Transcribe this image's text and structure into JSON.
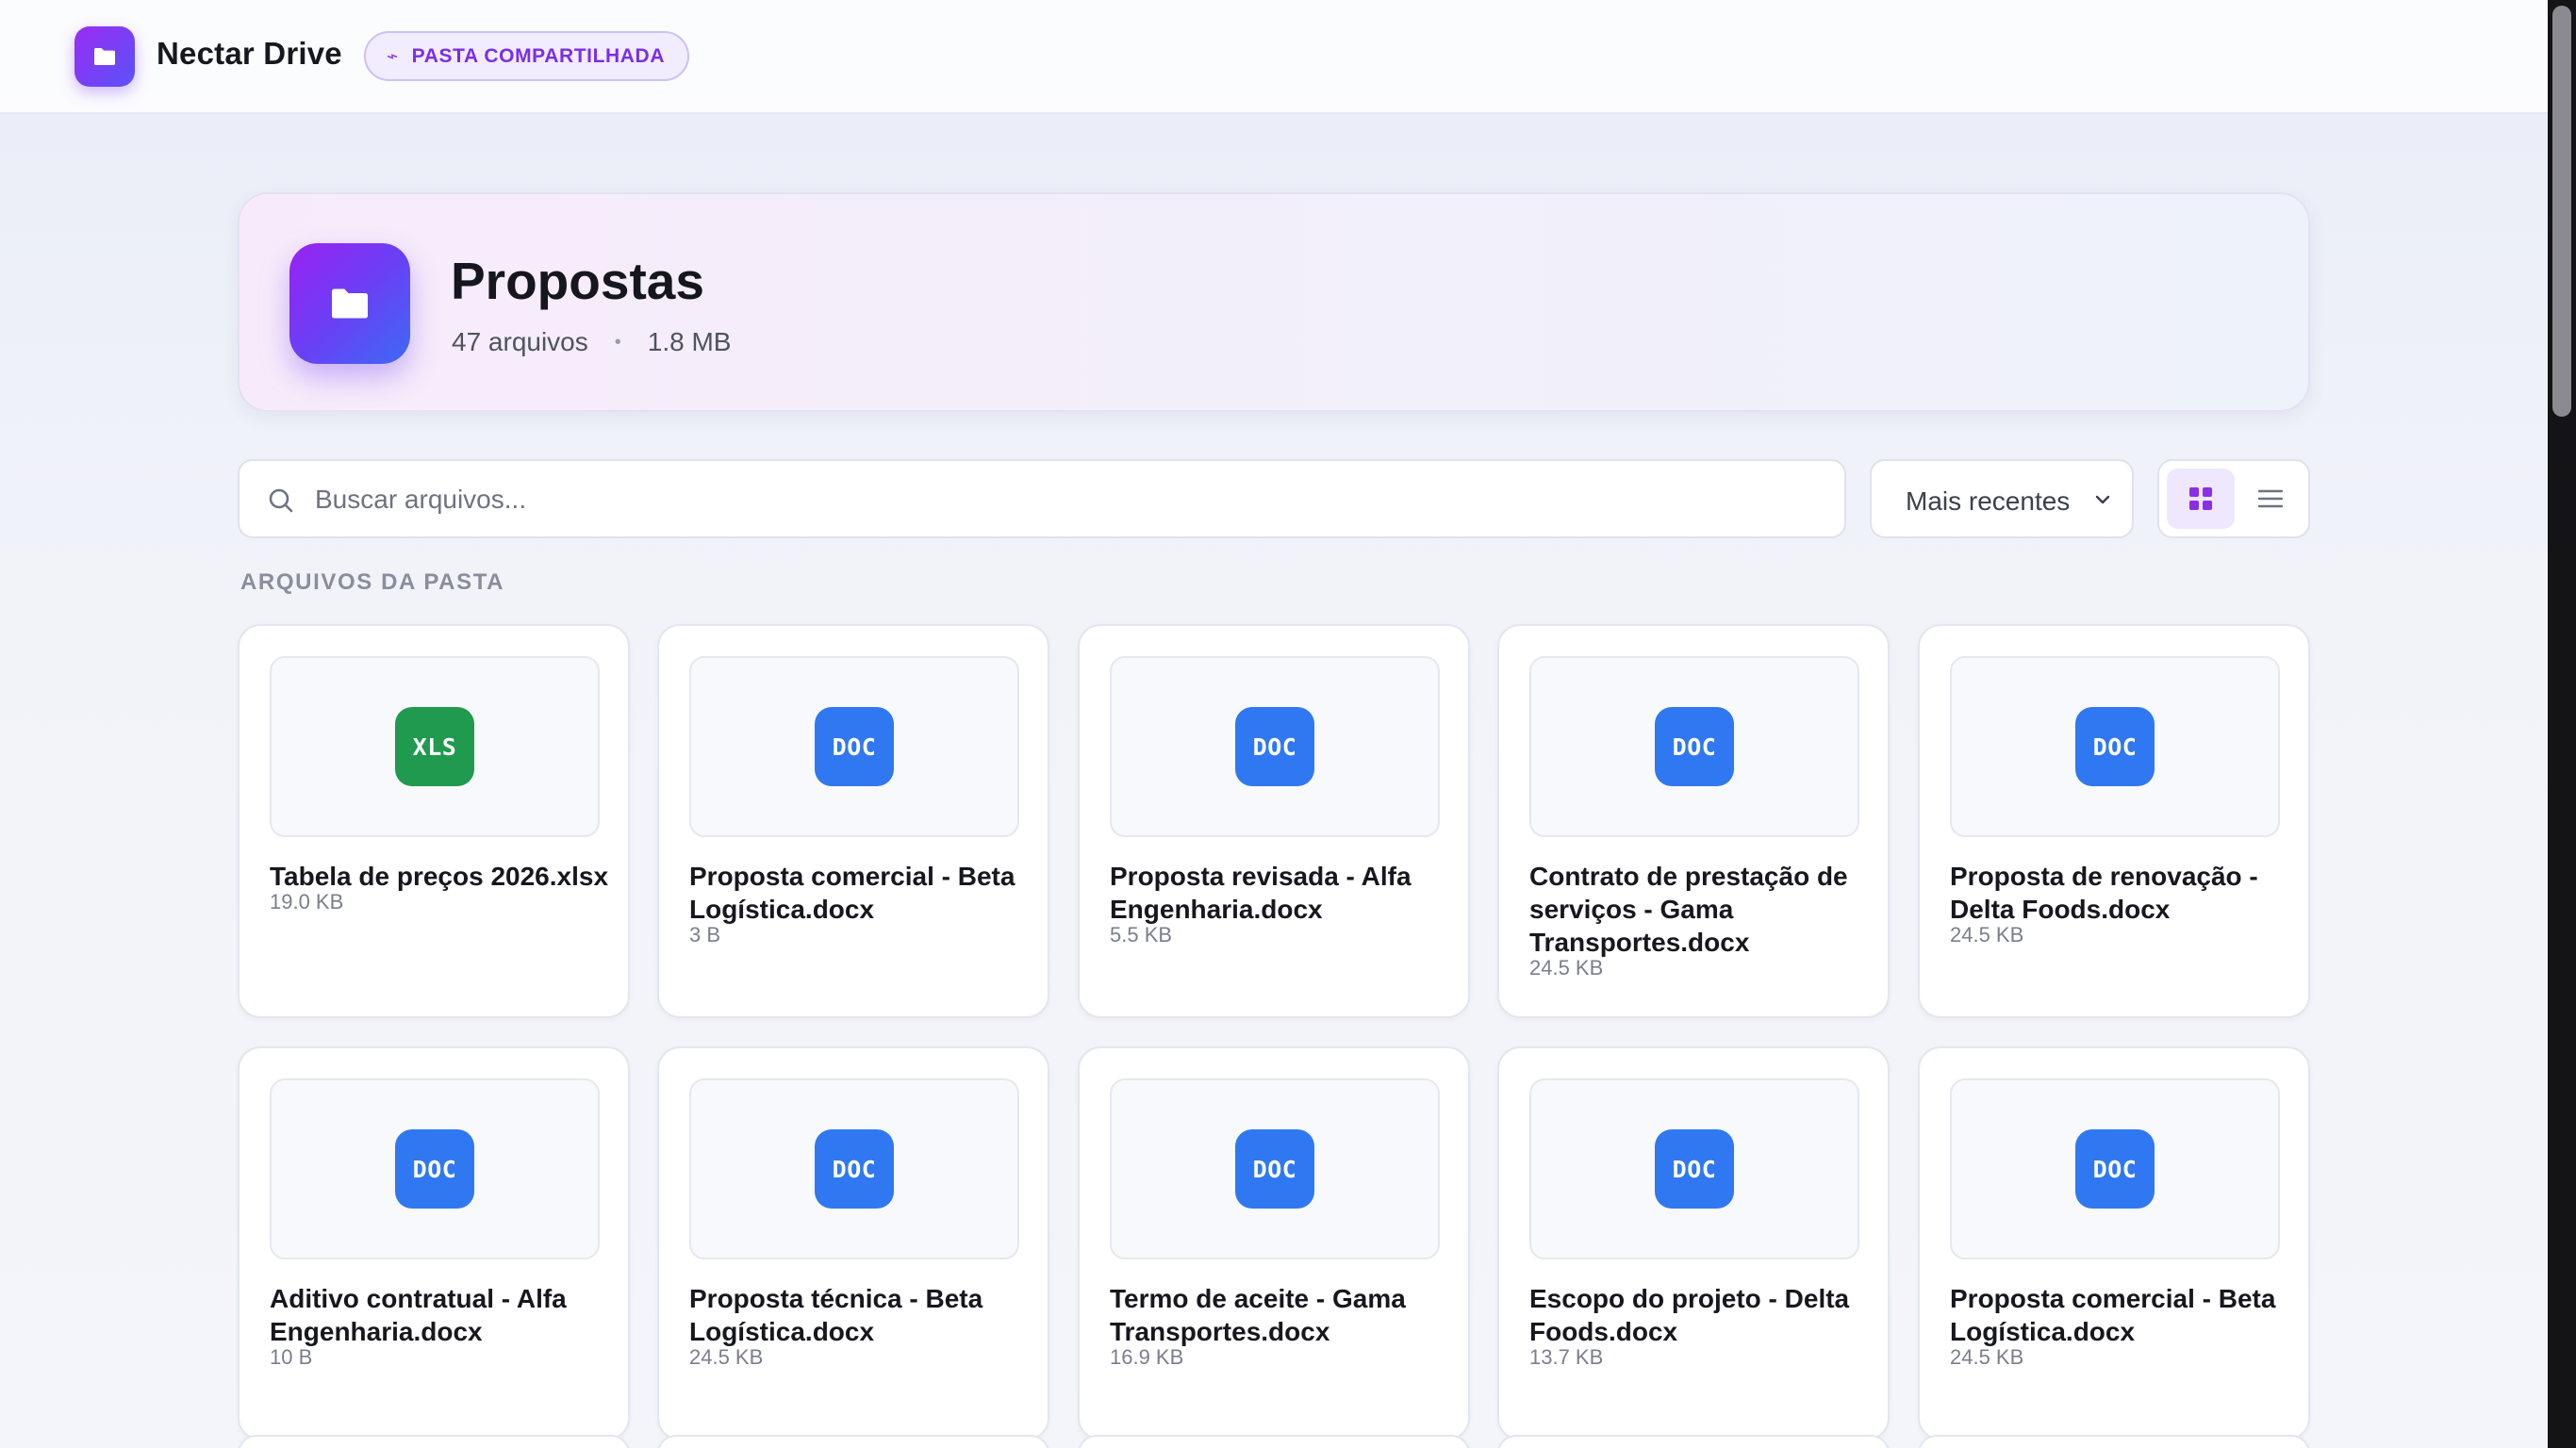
{
  "header": {
    "brand": "Nectar Drive",
    "badge_label": "PASTA COMPARTILHADA",
    "badge_icon": "link-icon",
    "logo_icon": "folder-icon"
  },
  "folder": {
    "name": "Propostas",
    "file_count": "47 arquivos",
    "separator": "•",
    "total_size": "1.8 MB",
    "icon": "folder-icon"
  },
  "search": {
    "placeholder": "Buscar arquivos...",
    "value": ""
  },
  "sort": {
    "selected": "Mais recentes"
  },
  "view_toggle": {
    "active": "grid"
  },
  "section_label": "ARQUIVOS DA PASTA",
  "colors": {
    "accent": "#7c3aed",
    "doc": "#2f78f1",
    "xls": "#1f9a4e"
  },
  "files": [
    {
      "type": "XLS",
      "name": "Tabela de preços 2026.xlsx",
      "size": "19.0 KB"
    },
    {
      "type": "DOC",
      "name": "Proposta comercial - Beta Logística.docx",
      "size": "3 B"
    },
    {
      "type": "DOC",
      "name": "Proposta revisada - Alfa Engenharia.docx",
      "size": "5.5 KB"
    },
    {
      "type": "DOC",
      "name": "Contrato de prestação de serviços - Gama Transportes.docx",
      "size": "24.5 KB"
    },
    {
      "type": "DOC",
      "name": "Proposta de renovação - Delta Foods.docx",
      "size": "24.5 KB"
    },
    {
      "type": "DOC",
      "name": "Aditivo contratual - Alfa Engenharia.docx",
      "size": "10 B"
    },
    {
      "type": "DOC",
      "name": "Proposta técnica - Beta Logística.docx",
      "size": "24.5 KB"
    },
    {
      "type": "DOC",
      "name": "Termo de aceite - Gama Transportes.docx",
      "size": "16.9 KB"
    },
    {
      "type": "DOC",
      "name": "Escopo do projeto - Delta Foods.docx",
      "size": "13.7 KB"
    },
    {
      "type": "DOC",
      "name": "Proposta comercial - Beta Logística.docx",
      "size": "24.5 KB"
    }
  ]
}
